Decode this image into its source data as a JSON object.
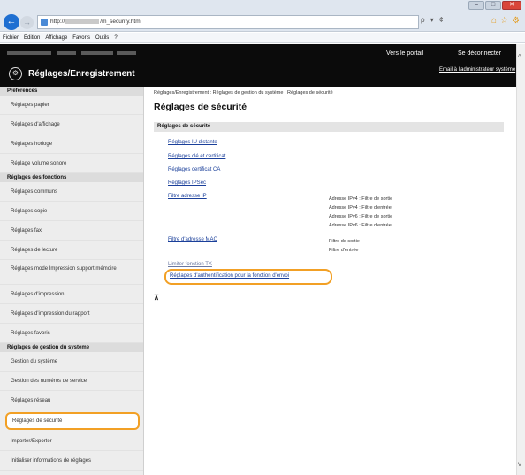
{
  "browser": {
    "url_prefix": "http://",
    "url_suffix": "/m_security.html",
    "search_hint": "ρ ▾ ¢",
    "menu": [
      "Fichier",
      "Edition",
      "Affichage",
      "Favoris",
      "Outils",
      "?"
    ]
  },
  "header": {
    "title": "Réglages/Enregistrement",
    "portal_link": "Vers le portail",
    "logout_link": "Se déconnecter",
    "email_link": "Email à l'administrateur système"
  },
  "sidebar": {
    "groups": [
      {
        "title": "Préférences",
        "items": [
          "Réglages papier",
          "Réglages d'affichage",
          "Réglages horloge",
          "Réglage volume sonore"
        ]
      },
      {
        "title": "Réglages des fonctions",
        "items": [
          "Réglages communs",
          "Réglages copie",
          "Réglages fax",
          "Réglages de lecture",
          "Réglages mode Impression support mémoire",
          "Réglages d'impression",
          "Réglages d'impression du rapport",
          "Réglages favoris"
        ]
      },
      {
        "title": "Réglages de gestion du système",
        "items": [
          "Gestion du système",
          "Gestion des numéros de service",
          "Réglages réseau",
          "Réglages de sécurité",
          "Importer/Exporter",
          "Initialiser informations de réglages"
        ]
      }
    ],
    "selected": "Réglages de sécurité"
  },
  "main": {
    "breadcrumb": "Réglages/Enregistrement : Réglages de gestion du système : Réglages de sécurité",
    "page_title": "Réglages de sécurité",
    "section_title": "Réglages de sécurité",
    "links": {
      "remote_ui": "Réglages IU distante",
      "key_cert": "Réglages clé et certificat",
      "ca_cert": "Réglages certificat CA",
      "ipsec": "Réglages IPSec",
      "ip_filter": "Filtre adresse IP",
      "mac_filter": "Filtre d'adresse MAC",
      "tx_limit": "Limiter fonction TX",
      "auth_send": "Réglages d'authentification pour la fonction d'envoi"
    },
    "ip_filter_desc": [
      "Adresse IPv4 : Filtre de sortie",
      "Adresse IPv4 : Filtre d'entrée",
      "Adresse IPv6 : Filtre de sortie",
      "Adresse IPv6 : Filtre d'entrée"
    ],
    "mac_filter_desc": [
      "Filtre de sortie",
      "Filtre d'entrée"
    ]
  }
}
